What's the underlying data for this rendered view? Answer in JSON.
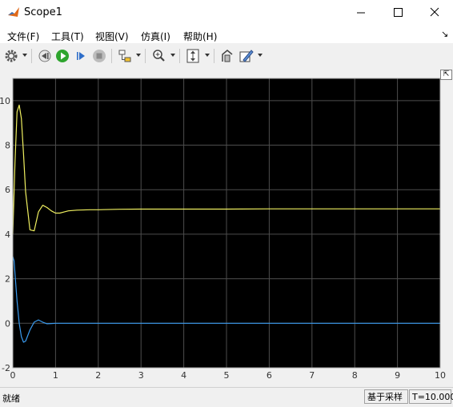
{
  "window": {
    "title": "Scope1"
  },
  "menu": {
    "items": [
      "文件(F)",
      "工具(T)",
      "视图(V)",
      "仿真(I)",
      "帮助(H)"
    ],
    "pin_glyph": "↘"
  },
  "toolbar": {
    "buttons": [
      {
        "icon": "gear-icon"
      },
      {
        "icon": "step-back-icon"
      },
      {
        "icon": "run-icon"
      },
      {
        "icon": "step-forward-icon"
      },
      {
        "icon": "stop-icon"
      },
      {
        "icon": "highlight-block-icon"
      },
      {
        "icon": "zoom-icon"
      },
      {
        "icon": "scale-y-icon"
      },
      {
        "icon": "restore-icon"
      },
      {
        "icon": "style-icon"
      }
    ]
  },
  "plot": {
    "background": "#000000",
    "grid_color": "#4d4d4d",
    "expand_glyph": "⇱"
  },
  "chart_data": {
    "type": "line",
    "xlim": [
      0,
      10
    ],
    "ylim": [
      -2,
      11
    ],
    "xticks": [
      "0",
      "1",
      "2",
      "3",
      "4",
      "5",
      "6",
      "7",
      "8",
      "9",
      "10"
    ],
    "yticks": [
      "-2",
      "0",
      "2",
      "4",
      "6",
      "8",
      "10"
    ],
    "grid": true,
    "series": [
      {
        "color": "#f0f060",
        "x": [
          0,
          0.05,
          0.1,
          0.15,
          0.2,
          0.25,
          0.3,
          0.4,
          0.5,
          0.6,
          0.7,
          0.8,
          0.9,
          1.0,
          1.1,
          1.2,
          1.3,
          1.5,
          1.8,
          2.0,
          2.5,
          3,
          4,
          5,
          6,
          7,
          8,
          9,
          10
        ],
        "y": [
          4.0,
          7.2,
          9.5,
          9.8,
          9.2,
          7.6,
          5.9,
          4.2,
          4.15,
          5.0,
          5.3,
          5.2,
          5.05,
          4.95,
          4.95,
          5.0,
          5.05,
          5.08,
          5.1,
          5.1,
          5.12,
          5.13,
          5.13,
          5.13,
          5.14,
          5.14,
          5.14,
          5.14,
          5.14
        ]
      },
      {
        "color": "#3a9bf0",
        "x": [
          0,
          0.03,
          0.06,
          0.1,
          0.15,
          0.2,
          0.25,
          0.3,
          0.35,
          0.4,
          0.5,
          0.6,
          0.7,
          0.8,
          0.9,
          1.0,
          1.2,
          1.5,
          2,
          4,
          6,
          8,
          10
        ],
        "y": [
          3.0,
          2.8,
          2.0,
          1.0,
          0.0,
          -0.6,
          -0.85,
          -0.8,
          -0.55,
          -0.3,
          0.05,
          0.15,
          0.05,
          -0.02,
          -0.01,
          0.0,
          0.0,
          0.0,
          0.0,
          0.0,
          0.0,
          0.0,
          0.0
        ]
      }
    ]
  },
  "status": {
    "left": "就绪",
    "mode": "基于采样",
    "time": "T=10.000"
  }
}
